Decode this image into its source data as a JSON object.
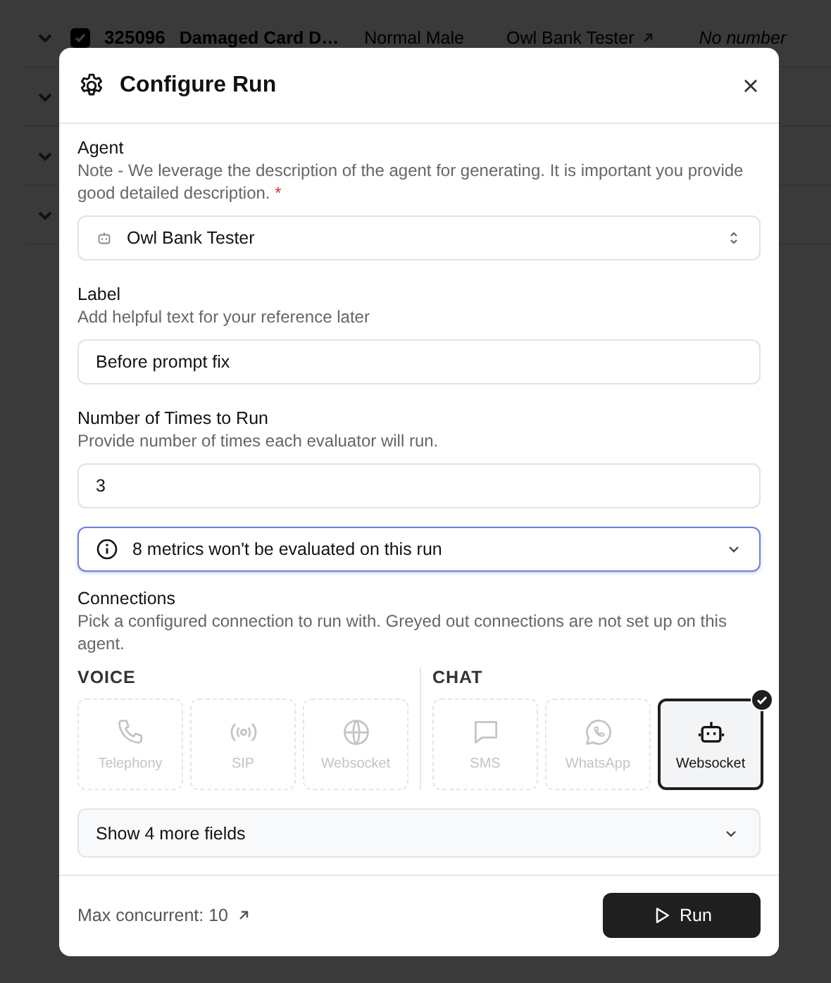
{
  "background_row": {
    "checked": true,
    "id": "325096",
    "name": "Damaged Card D…",
    "voice": "Normal Male",
    "agent": "Owl Bank Tester",
    "phone": "No number"
  },
  "dialog": {
    "title": "Configure Run",
    "agent": {
      "label": "Agent",
      "hint": "Note - We leverage the description of the agent for generating. It is important you provide good detailed description.",
      "required_mark": "*",
      "value": "Owl Bank Tester"
    },
    "label": {
      "label": "Label",
      "hint": "Add helpful text for your reference later",
      "value": "Before prompt fix"
    },
    "times": {
      "label": "Number of Times to Run",
      "hint": "Provide number of times each evaluator will run.",
      "value": "3"
    },
    "notice": {
      "text": "8 metrics won't be evaluated on this run",
      "expanded": false
    },
    "connections": {
      "label": "Connections",
      "hint": "Pick a configured connection to run with. Greyed out connections are not set up on this agent.",
      "groups": [
        {
          "title": "VOICE",
          "items": [
            {
              "kind": "phone",
              "label": "Telephony",
              "disabled": true,
              "selected": false
            },
            {
              "kind": "sip",
              "label": "SIP",
              "disabled": true,
              "selected": false
            },
            {
              "kind": "globe",
              "label": "Websocket",
              "disabled": true,
              "selected": false
            }
          ]
        },
        {
          "title": "CHAT",
          "items": [
            {
              "kind": "sms",
              "label": "SMS",
              "disabled": true,
              "selected": false
            },
            {
              "kind": "whatsapp",
              "label": "WhatsApp",
              "disabled": true,
              "selected": false
            },
            {
              "kind": "robot",
              "label": "Websocket",
              "disabled": false,
              "selected": true
            }
          ]
        }
      ]
    },
    "more_fields": "Show 4 more fields",
    "footer": {
      "max_concurrent": "Max concurrent: 10",
      "run_button": "Run"
    }
  }
}
